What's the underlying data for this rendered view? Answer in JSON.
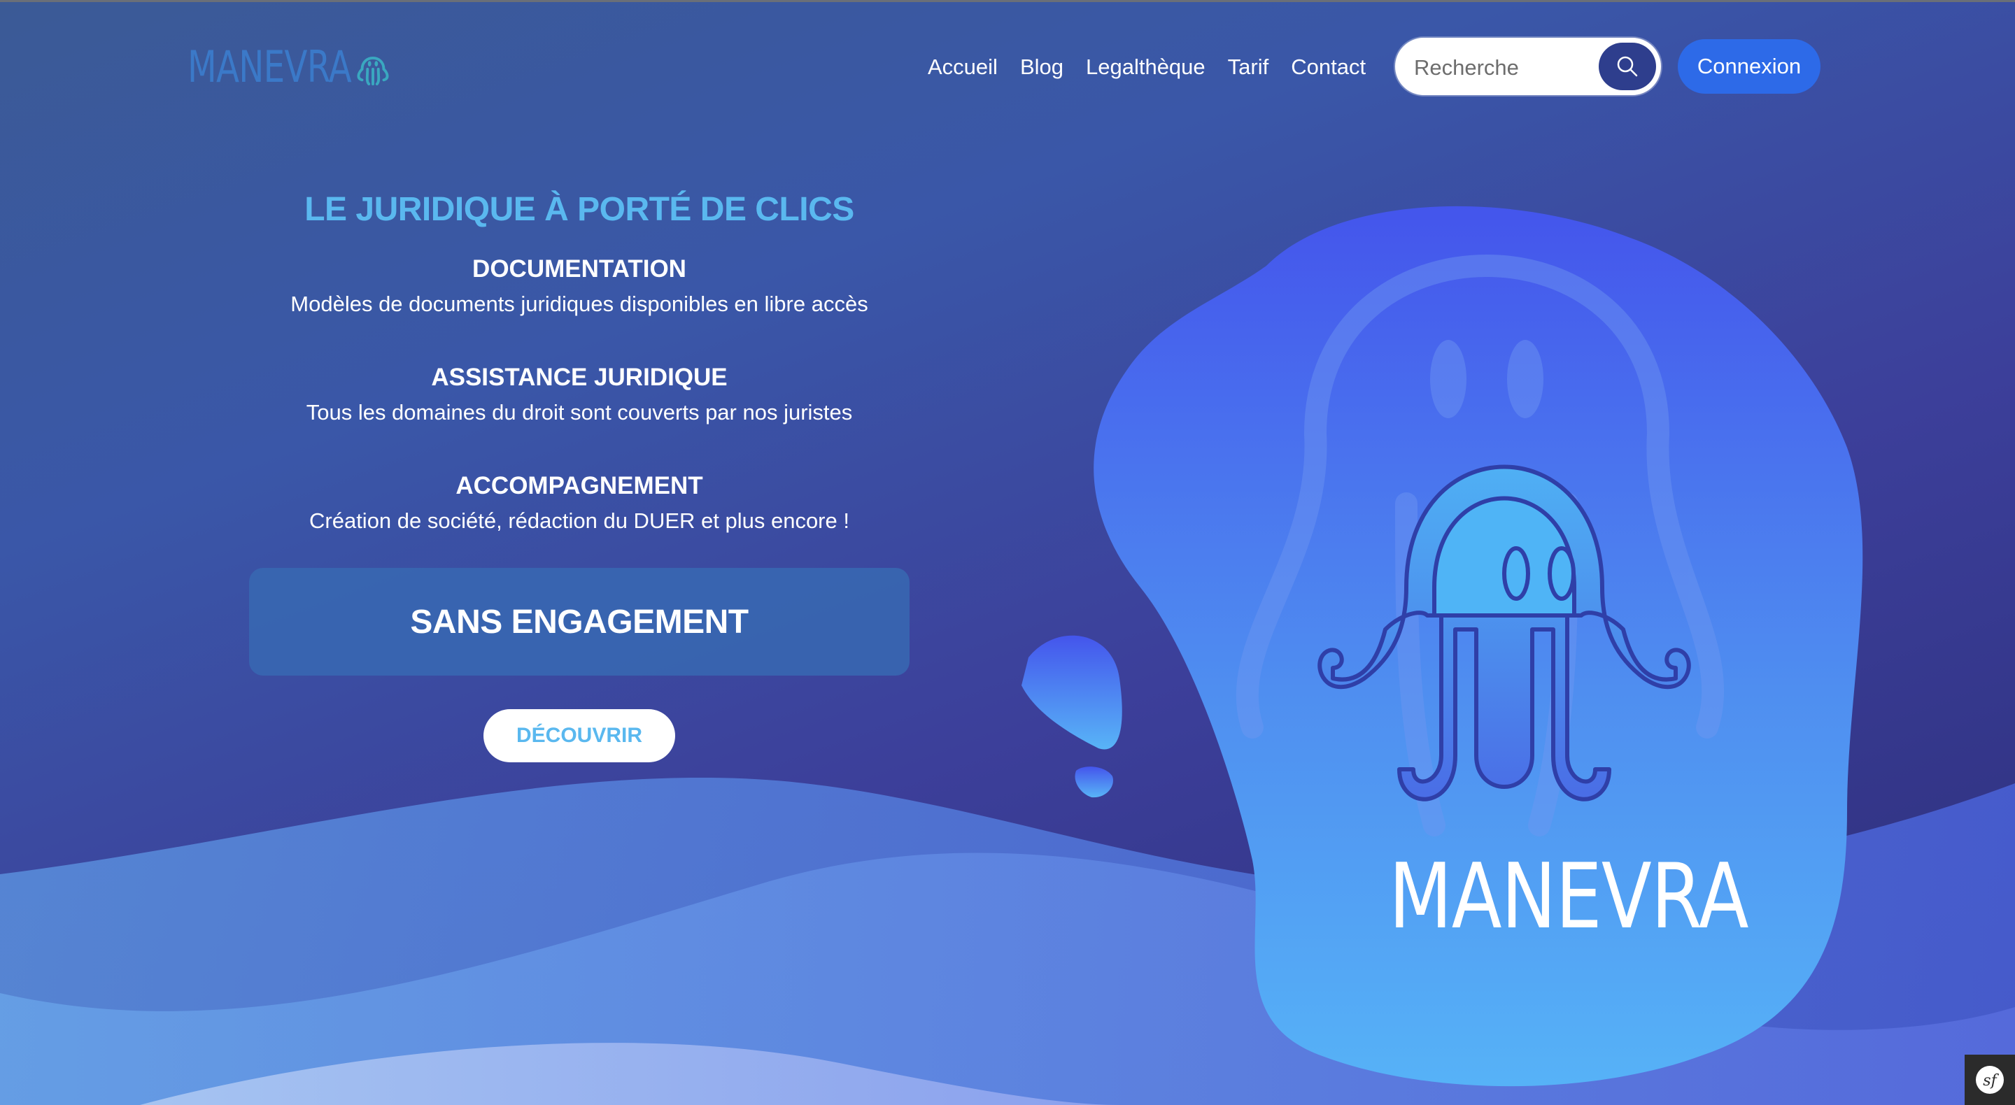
{
  "header": {
    "logo_text": "MANEVRA",
    "nav": [
      "Accueil",
      "Blog",
      "Legalthèque",
      "Tarif",
      "Contact"
    ],
    "search_placeholder": "Recherche",
    "login_label": "Connexion"
  },
  "hero": {
    "tagline": "LE JURIDIQUE À PORTÉ DE CLICS",
    "features": [
      {
        "title": "DOCUMENTATION",
        "description": "Modèles de documents juridiques disponibles en libre accès"
      },
      {
        "title": "ASSISTANCE JURIDIQUE",
        "description": "Tous les domaines du droit sont couverts par nos juristes"
      },
      {
        "title": "ACCOMPAGNEMENT",
        "description": "Création de société, rédaction du DUER et plus encore !"
      }
    ],
    "engagement_label": "SANS ENGAGEMENT",
    "discover_label": "DÉCOUVRIR"
  },
  "brand_art": {
    "wordmark": "MANEVRA"
  },
  "icons": {
    "logo_icon": "octopus-icon",
    "search": "search-icon",
    "dev_toolbar": "symfony-icon"
  },
  "colors": {
    "accent_light_blue": "#5ab8ef",
    "button_blue": "#2d6ae8",
    "search_button": "#2e3e8d",
    "logo_blue": "#3b79c8"
  }
}
